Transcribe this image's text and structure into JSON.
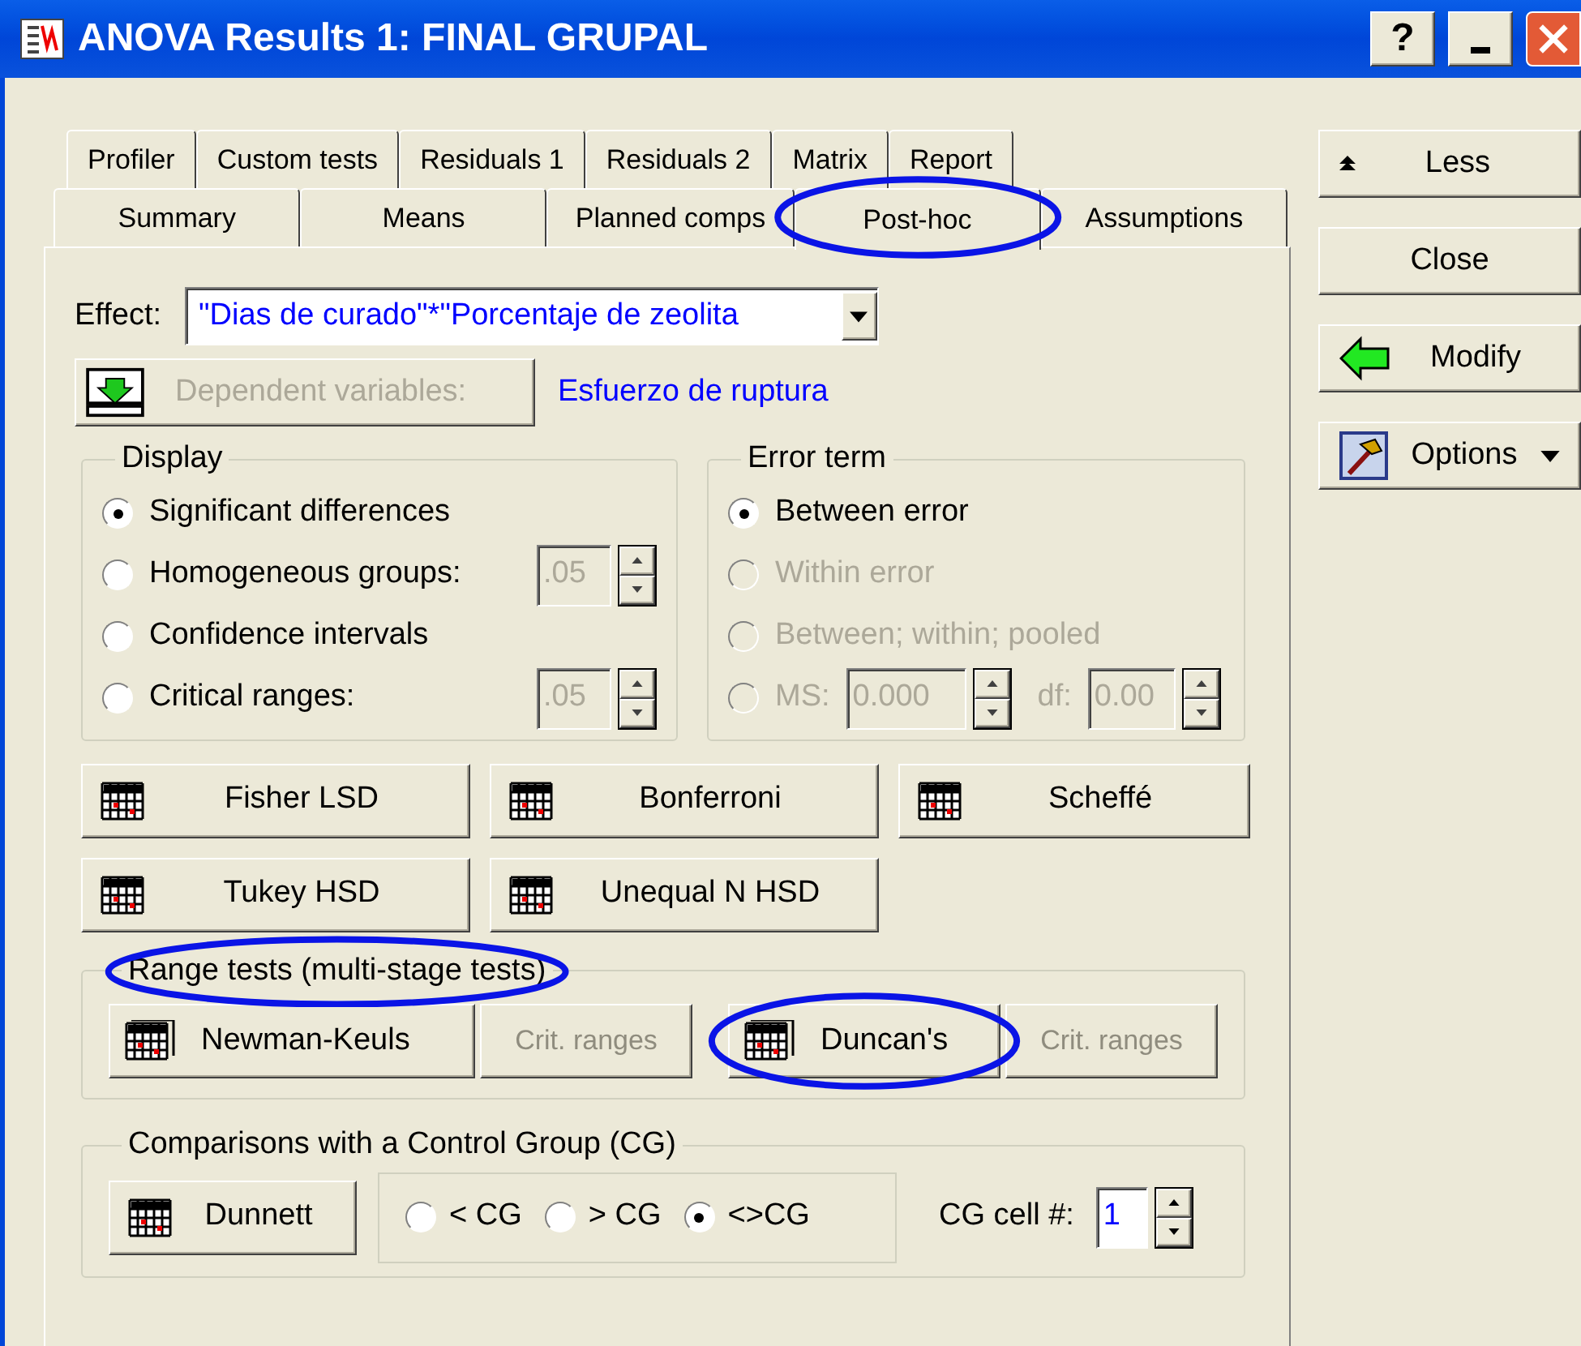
{
  "window": {
    "title": "ANOVA Results 1: FINAL GRUPAL",
    "help": "?"
  },
  "tab_rows": [
    {
      "tabs": [
        {
          "label": "Profiler",
          "selected": false,
          "highlighted": false
        },
        {
          "label": "Custom tests",
          "selected": false,
          "highlighted": false
        },
        {
          "label": "Residuals 1",
          "selected": false,
          "highlighted": false
        },
        {
          "label": "Residuals 2",
          "selected": false,
          "highlighted": false
        },
        {
          "label": "Matrix",
          "selected": false,
          "highlighted": false
        },
        {
          "label": "Report",
          "selected": false,
          "highlighted": false
        }
      ]
    },
    {
      "tabs": [
        {
          "label": "Summary",
          "selected": false,
          "highlighted": false
        },
        {
          "label": "Means",
          "selected": false,
          "highlighted": false
        },
        {
          "label": "Planned comps",
          "selected": false,
          "highlighted": false
        },
        {
          "label": "Post-hoc",
          "selected": true,
          "highlighted": true
        },
        {
          "label": "Assumptions",
          "selected": false,
          "highlighted": false
        }
      ]
    }
  ],
  "side_buttons": [
    {
      "label": "Less",
      "kind": "less"
    },
    {
      "label": "Close",
      "kind": "plain"
    },
    {
      "label": "Modify",
      "kind": "modify"
    },
    {
      "label": "Options",
      "kind": "menu"
    }
  ],
  "effect": {
    "label": "Effect:",
    "value": "\"Dias de curado\"*\"Porcentaje de zeolita"
  },
  "dependent": {
    "button": "Dependent variables:",
    "disabled": true,
    "value": "Esfuerzo de ruptura"
  },
  "display": {
    "title": "Display",
    "options": [
      {
        "label": "Significant differences",
        "selected": true,
        "disabled": false
      },
      {
        "label": "Homogeneous groups:",
        "selected": false,
        "disabled": false,
        "spin": {
          "value": ".05",
          "disabled": true
        }
      },
      {
        "label": "Confidence intervals",
        "selected": false,
        "disabled": false
      },
      {
        "label": "Critical ranges:",
        "selected": false,
        "disabled": false,
        "spin": {
          "value": ".05",
          "disabled": true
        }
      }
    ]
  },
  "error_term": {
    "title": "Error term",
    "options": [
      {
        "label": "Between error",
        "selected": true,
        "disabled": false
      },
      {
        "label": "Within error",
        "selected": false,
        "disabled": true
      },
      {
        "label": "Between; within; pooled",
        "selected": false,
        "disabled": true
      },
      {
        "label": "MS:",
        "selected": false,
        "disabled": true,
        "spin": {
          "value": "0.000",
          "disabled": true
        },
        "extra_label": "df:",
        "extra_spin": {
          "value": "0.00",
          "disabled": true
        }
      }
    ]
  },
  "test_buttons": [
    {
      "label": "Fisher LSD"
    },
    {
      "label": "Bonferroni"
    },
    {
      "label": "Scheffé"
    },
    {
      "label": "Tukey HSD"
    },
    {
      "label": "Unequal N HSD"
    }
  ],
  "range_tests": {
    "title": "Range tests (multi-stage tests)",
    "highlighted": true,
    "tests": [
      {
        "label": "Newman-Keuls",
        "highlighted": false,
        "crit": {
          "label": "Crit. ranges",
          "disabled": true
        }
      },
      {
        "label": "Duncan's",
        "highlighted": true,
        "crit": {
          "label": "Crit. ranges",
          "disabled": true
        }
      }
    ]
  },
  "control_group": {
    "title": "Comparisons with a Control Group (CG)",
    "button": "Dunnett",
    "options": [
      {
        "label": "< CG",
        "selected": false
      },
      {
        "label": "> CG",
        "selected": false
      },
      {
        "label": "<>CG",
        "selected": true
      }
    ],
    "cell_label": "CG cell #:",
    "cell_value": "1"
  }
}
